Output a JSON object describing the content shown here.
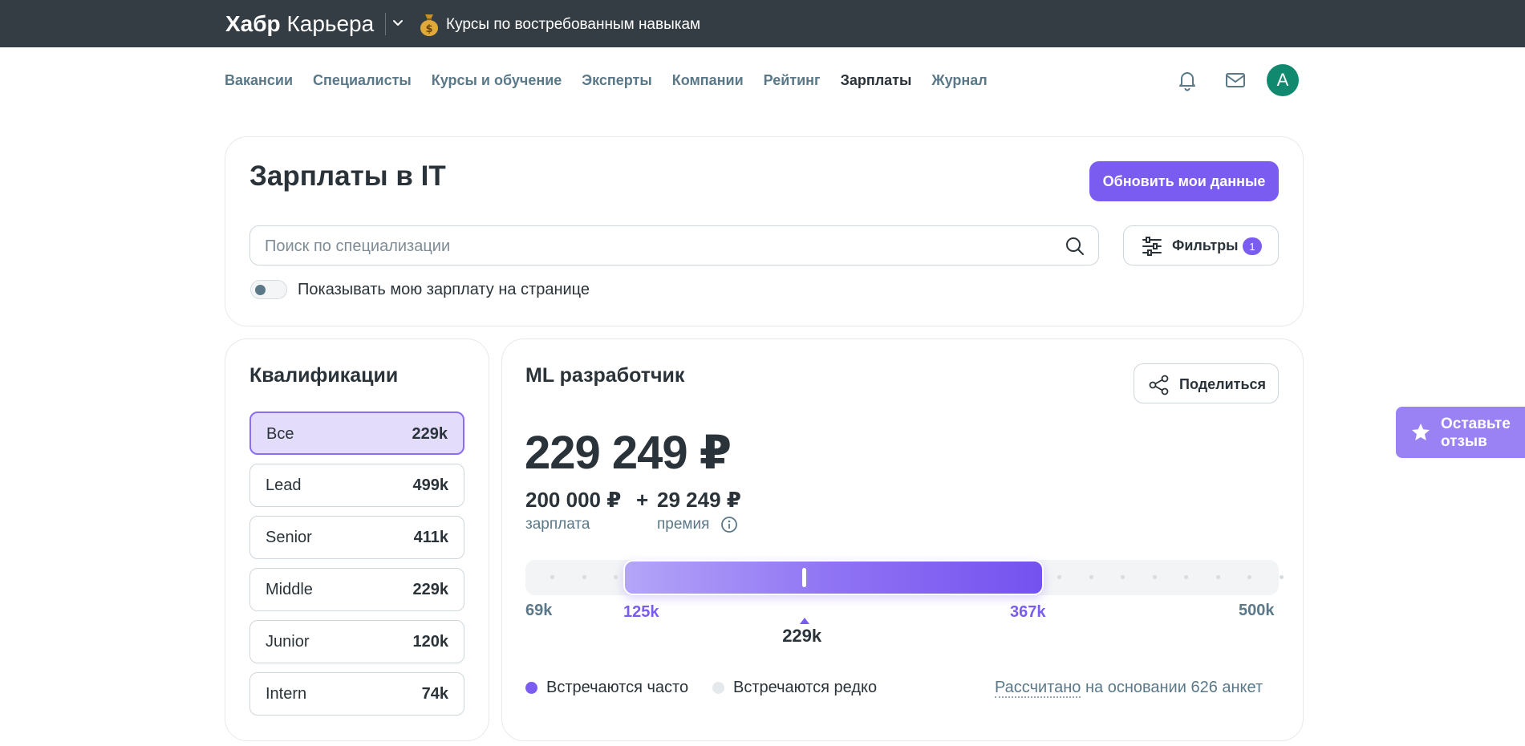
{
  "topbar": {
    "brand_bold": "Хабр",
    "brand_rest": "Карьера",
    "course_link": "Курсы по востребованным навыкам"
  },
  "nav": {
    "items": [
      "Вакансии",
      "Специалисты",
      "Курсы и обучение",
      "Эксперты",
      "Компании",
      "Рейтинг",
      "Зарплаты",
      "Журнал"
    ],
    "active": "Зарплаты",
    "avatar_letter": "A"
  },
  "header": {
    "title": "Зарплаты в IT",
    "update_button": "Обновить мои данные",
    "search_placeholder": "Поиск по специализации",
    "search_value": "",
    "filters_label": "Фильтры",
    "filters_count": "1",
    "toggle_label": "Показывать мою зарплату на странице",
    "toggle_on": false
  },
  "qualifications": {
    "title": "Квалификации",
    "items": [
      {
        "label": "Все",
        "value": "229k",
        "active": true
      },
      {
        "label": "Lead",
        "value": "499k",
        "active": false
      },
      {
        "label": "Senior",
        "value": "411k",
        "active": false
      },
      {
        "label": "Middle",
        "value": "229k",
        "active": false
      },
      {
        "label": "Junior",
        "value": "120k",
        "active": false
      },
      {
        "label": "Intern",
        "value": "74k",
        "active": false
      }
    ]
  },
  "salary": {
    "role": "ML разработчик",
    "share_label": "Поделиться",
    "total": "229 249 ₽",
    "base": "200 000 ₽",
    "plus": "+",
    "bonus": "29 249 ₽",
    "base_label": "зарплата",
    "bonus_label": "премия",
    "scale": {
      "min": 69,
      "low": 125,
      "median": 229,
      "high": 367,
      "max": 500,
      "unit": "k"
    },
    "tick_min": "69k",
    "tick_low": "125k",
    "tick_median": "229k",
    "tick_high": "367k",
    "tick_max": "500k",
    "legend_often": "Встречаются часто",
    "legend_rare": "Встречаются редко",
    "basis_link": "Рассчитано",
    "basis_rest": "на основании 626 анкет"
  },
  "feedback": {
    "label": "Оставьте отзыв"
  },
  "colors": {
    "accent": "#7b5cf0",
    "topbar": "#343d44",
    "nav_text": "#5a7888",
    "avatar": "#11896f"
  }
}
